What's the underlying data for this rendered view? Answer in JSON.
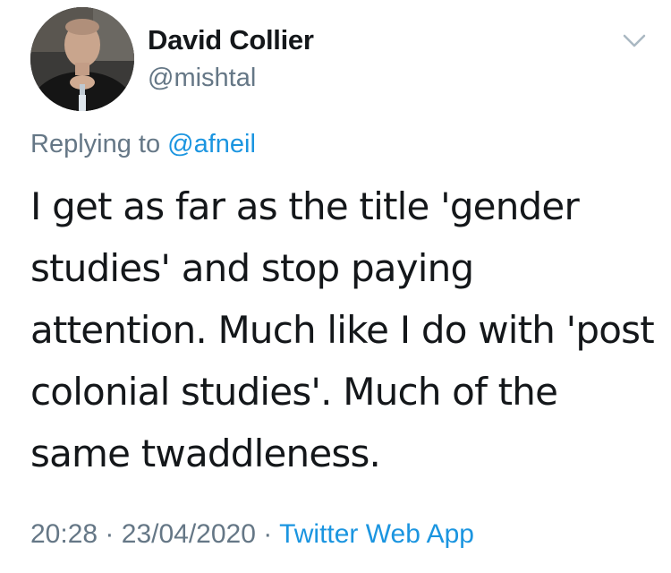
{
  "author": {
    "display_name": "David Collier",
    "handle": "@mishtal"
  },
  "reply": {
    "prefix": "Replying to",
    "mention": "@afneil"
  },
  "tweet": {
    "lines": [
      "I get as far as the title 'gender",
      "studies' and stop paying",
      "attention. Much like I do with 'post",
      "colonial studies'. Much of the",
      "same twaddleness."
    ]
  },
  "meta": {
    "time": "20:28",
    "separator": "·",
    "date": "23/04/2020",
    "source": "Twitter Web App"
  },
  "icons": {
    "menu": "chevron-down-icon",
    "avatar": "profile-photo"
  },
  "colors": {
    "text": "#14171a",
    "secondary": "#657786",
    "link": "#1b95e0"
  }
}
